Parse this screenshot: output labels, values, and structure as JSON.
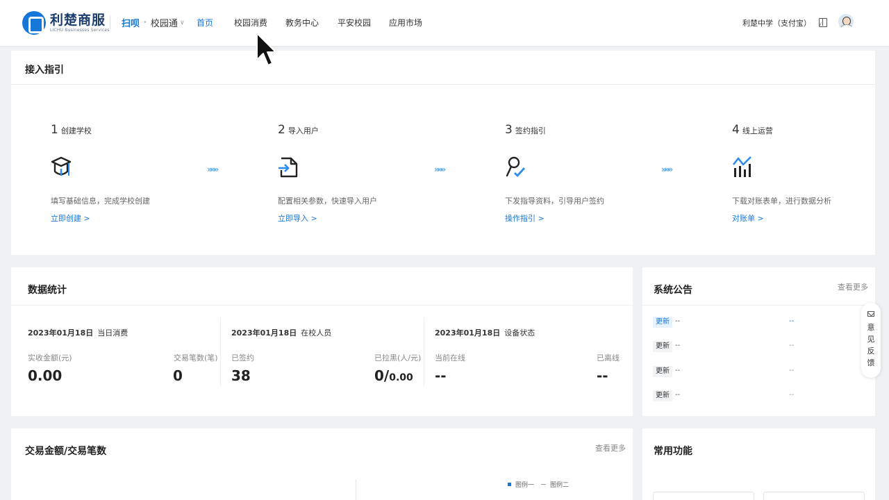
{
  "header": {
    "logo": {
      "cn": "利楚商服",
      "en": "LICHU Businesses Services"
    },
    "product": {
      "logo": "扫呗",
      "name": "校园通"
    },
    "nav": [
      "首页",
      "校园消费",
      "教务中心",
      "平安校园",
      "应用市场"
    ],
    "school": "利楚中学（支付宝）",
    "icons": [
      "book-icon",
      "avatar"
    ]
  },
  "guide": {
    "title": "接入指引",
    "steps": [
      {
        "num": "1",
        "title": "创建学校",
        "icon": "graduation-cap-icon",
        "desc": "填写基础信息，完成学校创建",
        "link": "立即创建 >"
      },
      {
        "num": "2",
        "title": "导入用户",
        "icon": "import-document-icon",
        "desc": "配置相关参数，快速导入用户",
        "link": "立即导入 >"
      },
      {
        "num": "3",
        "title": "签约指引",
        "icon": "user-check-icon",
        "desc": "下发指导资料，引导用户签约",
        "link": "操作指引 >"
      },
      {
        "num": "4",
        "title": "线上运营",
        "icon": "bar-chart-icon",
        "desc": "下载对账表单，进行数据分析",
        "link": "对账单 >"
      }
    ],
    "arrow": "»»»"
  },
  "stats": {
    "title": "数据统计",
    "cols": [
      {
        "date": "2023年01月18日",
        "label": "当日消费",
        "left_label": "实收金额(元)",
        "left_value": "0.00",
        "right_label": "交易笔数(笔)",
        "right_value": "0"
      },
      {
        "date": "2023年01月18日",
        "label": "在校人员",
        "left_label": "已签约",
        "left_value": "38",
        "right_label": "已拉黑(人/元)",
        "right_value_main": "0/",
        "right_value_small": "0.00"
      },
      {
        "date": "2023年01月18日",
        "label": "设备状态",
        "left_label": "当前在线",
        "left_value": "--",
        "right_label": "已离线",
        "right_value": "--"
      }
    ]
  },
  "notices": {
    "title": "系统公告",
    "more": "查看更多",
    "items": [
      {
        "tag": "更新",
        "text": "--",
        "date": "--",
        "highlight": true
      },
      {
        "tag": "更新",
        "text": "--",
        "date": "--",
        "highlight": false
      },
      {
        "tag": "更新",
        "text": "--",
        "date": "--",
        "highlight": false
      },
      {
        "tag": "更新",
        "text": "--",
        "date": "--",
        "highlight": false
      }
    ]
  },
  "feedback": {
    "label": "意见反馈"
  },
  "transactions": {
    "title": "交易金额/交易笔数",
    "more": "查看更多",
    "legend": [
      "图例一",
      "图例二"
    ]
  },
  "functions": {
    "title": "常用功能"
  },
  "colors": {
    "accent": "#1677d8",
    "arrow": "#52a8ee",
    "background": "#f0f1f3"
  }
}
